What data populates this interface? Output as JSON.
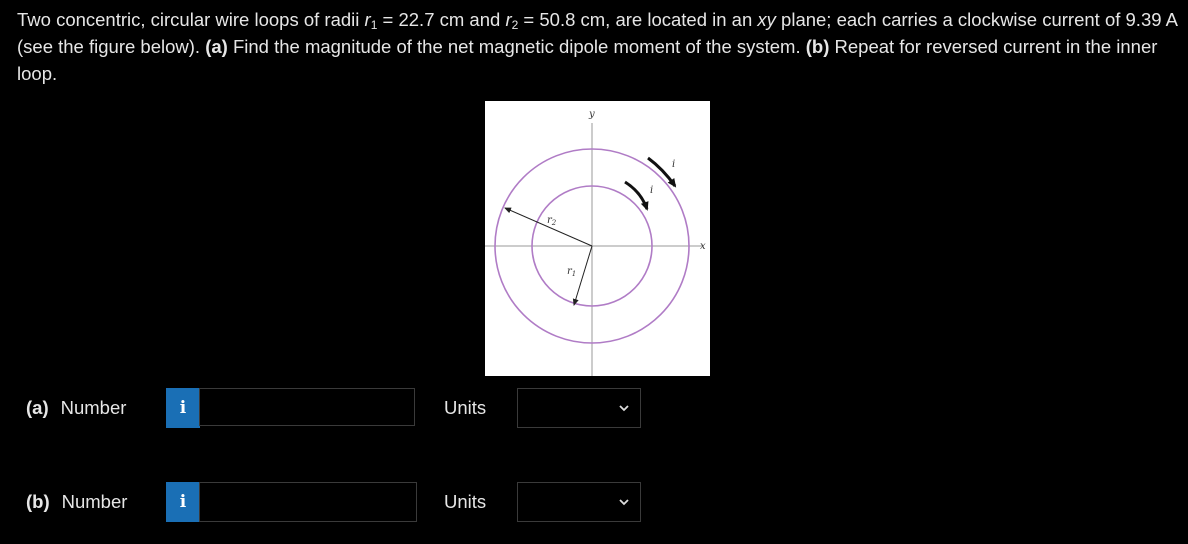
{
  "problem": {
    "t1": "Two concentric, circular wire loops of radii ",
    "r1_sym": "r",
    "r1_sub": "1",
    "t2": " = 22.7 cm and ",
    "r2_sym": "r",
    "r2_sub": "2",
    "t3": " = 50.8 cm, are located in an ",
    "xy": "xy",
    "t4": " plane; each carries a clockwise current of 9.39 A (see the figure below). ",
    "a_label": "(a)",
    "a_text": " Find the magnitude of the net magnetic dipole moment of the system. ",
    "b_label": "(b)",
    "b_text": " Repeat for reversed current in the inner loop."
  },
  "figure": {
    "axis_y": "y",
    "axis_x": "x",
    "label_r1": "r",
    "label_r1_sub": "1",
    "label_r2": "r",
    "label_r2_sub": "2",
    "label_i_outer": "i",
    "label_i_inner": "i",
    "loop_color": "#b07cc6"
  },
  "answers": [
    {
      "part": "(a)",
      "number_label": "Number",
      "info_glyph": "i",
      "number_value": "",
      "units_label": "Units",
      "units_selected": ""
    },
    {
      "part": "(b)",
      "number_label": "Number",
      "info_glyph": "i",
      "number_value": "",
      "units_label": "Units",
      "units_selected": ""
    }
  ],
  "colors": {
    "info_button": "#1a6fb5",
    "background": "#000000",
    "text": "#e6e6e6"
  }
}
